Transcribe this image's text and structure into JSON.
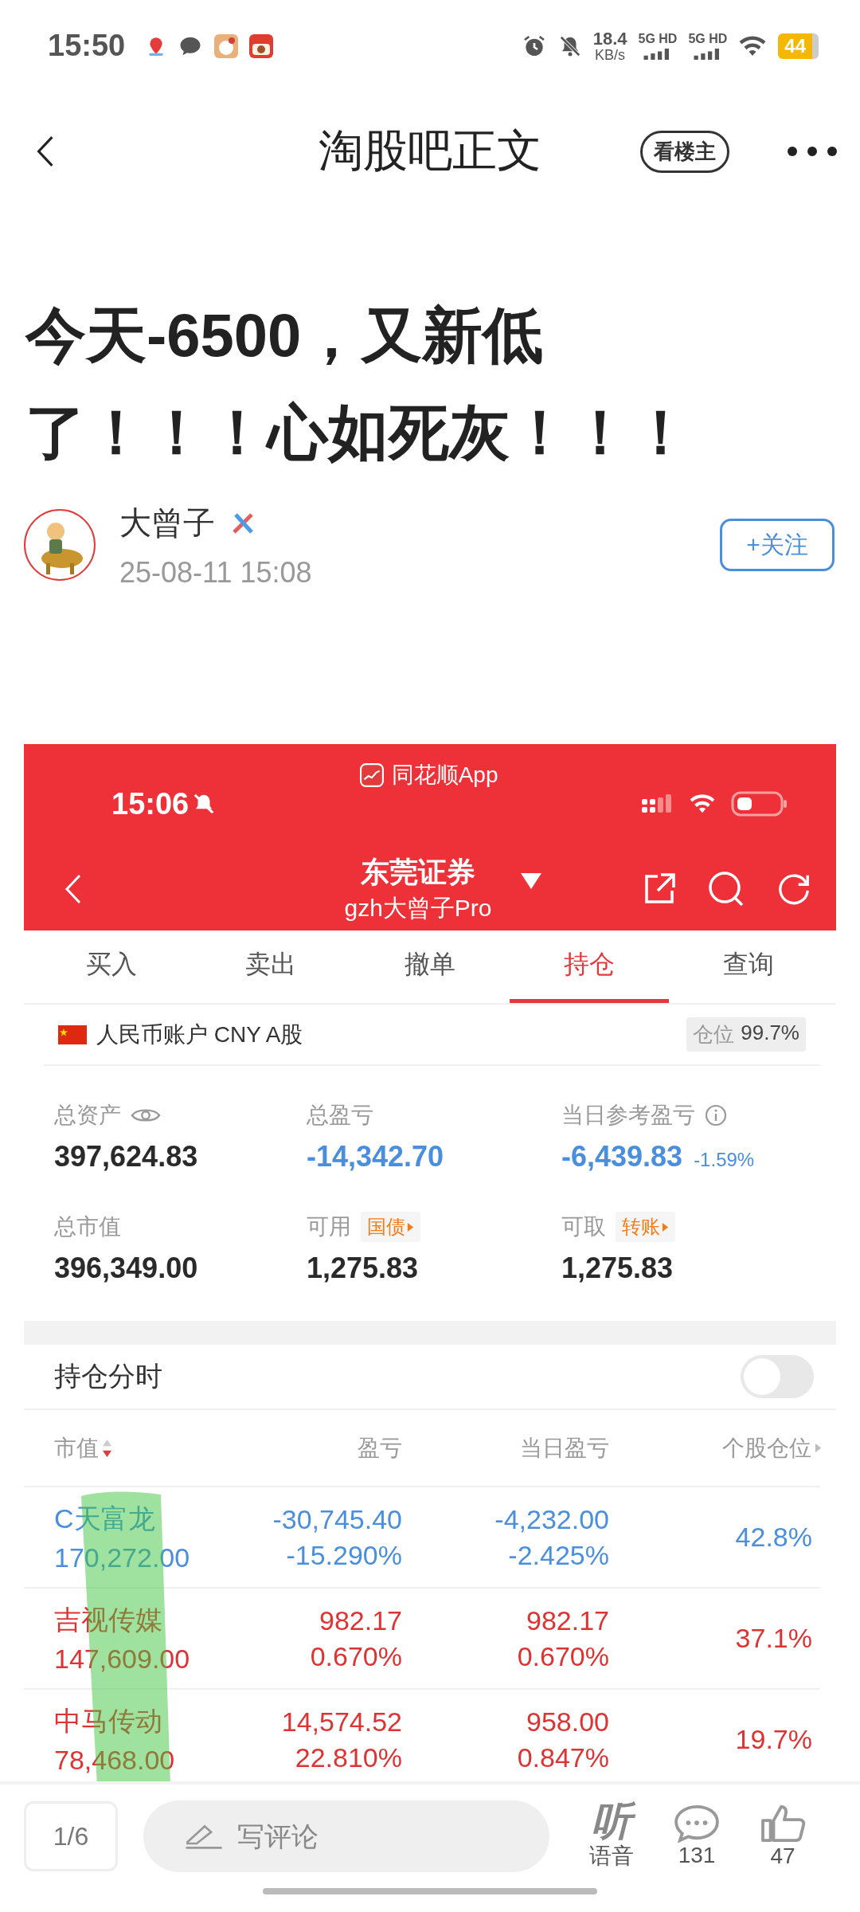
{
  "status_bar": {
    "time": "15:50",
    "network_speed": "18.4",
    "speed_unit": "KB/s",
    "sim_1": "5G HD",
    "sim_2": "5G HD",
    "battery": "44"
  },
  "header": {
    "title": "淘股吧正文",
    "op_only_button": "看楼主"
  },
  "post": {
    "title": "今天-6500，又新低了！！！心如死灰！！！",
    "author": "大曾子",
    "time": "25-08-11 15:08",
    "follow_button": "+关注"
  },
  "screenshot": {
    "status_time": "15:06",
    "app_name": "同花顺App",
    "broker": "东莞证券",
    "account": "gzh大曾子Pro",
    "tabs": [
      {
        "label": "买入",
        "selected": false
      },
      {
        "label": "卖出",
        "selected": false
      },
      {
        "label": "撤单",
        "selected": false
      },
      {
        "label": "持仓",
        "selected": true
      },
      {
        "label": "查询",
        "selected": false
      }
    ],
    "account_type": "人民币账户 CNY A股",
    "position_label": "仓位",
    "position_value": "99.7%",
    "stats": [
      {
        "label": "总资产",
        "value": "397,624.83",
        "color": "#2a2a2a",
        "kind": "eye"
      },
      {
        "label": "总盈亏",
        "value": "-14,342.70",
        "color": "#4a8fdd",
        "kind": "plain"
      },
      {
        "label": "当日参考盈亏",
        "value": "-6,439.83",
        "change": "-1.59%",
        "color": "#4a8fdd",
        "kind": "info"
      },
      {
        "label": "总市值",
        "value": "396,349.00",
        "color": "#2a2a2a",
        "kind": "plain"
      },
      {
        "label": "可用",
        "value": "1,275.83",
        "tag": "国债",
        "color": "#2a2a2a",
        "kind": "tag"
      },
      {
        "label": "可取",
        "value": "1,275.83",
        "tag": "转账",
        "color": "#2a2a2a",
        "kind": "tag"
      }
    ],
    "intraday_toggle": {
      "label": "持仓分时",
      "on": false
    },
    "columns": [
      "市值",
      "盈亏",
      "当日盈亏",
      "个股仓位"
    ],
    "rows": [
      {
        "name": "C天富龙",
        "market_value": "170,272.00",
        "pnl": "-30,745.40",
        "pnl_pct": "-15.290%",
        "day_pnl": "-4,232.00",
        "day_pnl_pct": "-2.425%",
        "weight": "42.8%",
        "color": "#4a8fdd"
      },
      {
        "name": "吉视传媒",
        "market_value": "147,609.00",
        "pnl": "982.17",
        "pnl_pct": "0.670%",
        "day_pnl": "982.17",
        "day_pnl_pct": "0.670%",
        "weight": "37.1%",
        "color": "#dd3333"
      },
      {
        "name": "中马传动",
        "market_value": "78,468.00",
        "pnl": "14,574.52",
        "pnl_pct": "22.810%",
        "day_pnl": "958.00",
        "day_pnl_pct": "0.847%",
        "weight": "19.7%",
        "color": "#dd3333"
      }
    ]
  },
  "bottom_bar": {
    "page": "1/6",
    "comment_placeholder": "写评论",
    "listen_glyph": "听",
    "listen_label": "语音",
    "comments": "131",
    "likes": "47"
  }
}
